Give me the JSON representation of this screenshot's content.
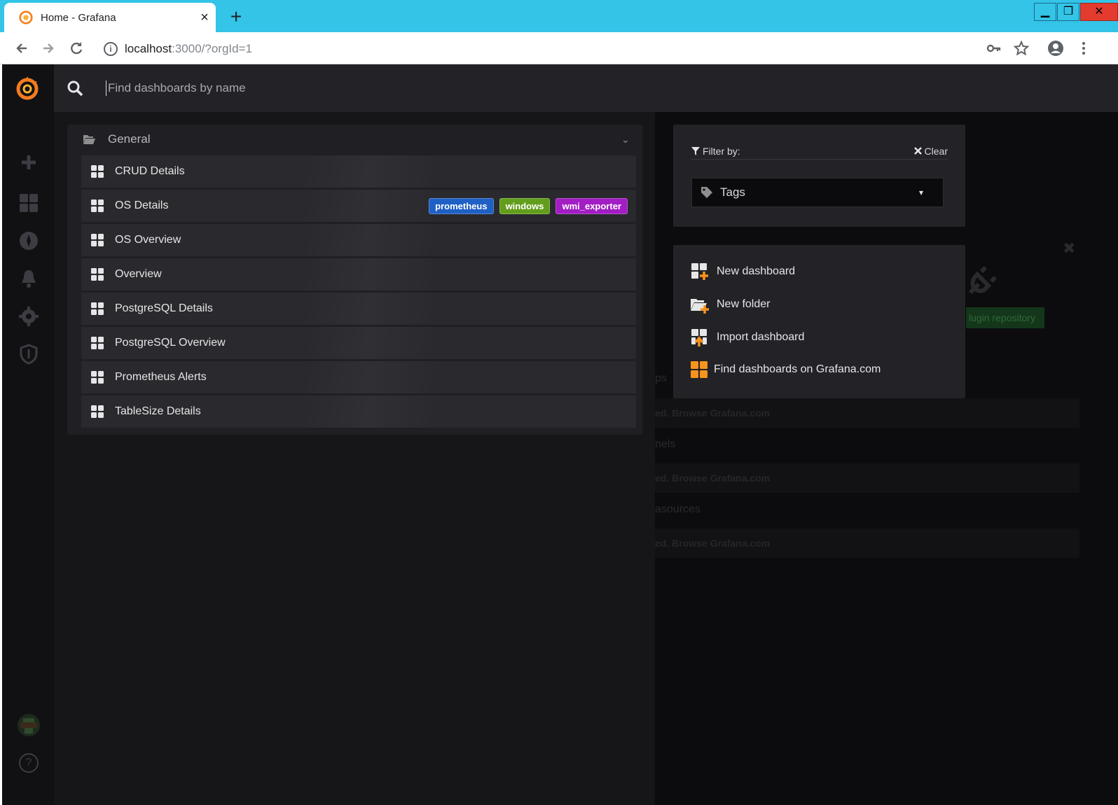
{
  "browser": {
    "tab_title": "Home - Grafana",
    "tab_close": "×",
    "new_tab": "+",
    "window_min": "▁",
    "window_max": "❐",
    "window_close": "✕",
    "url_host": "localhost",
    "url_path": ":3000/?orgId=1",
    "info_icon": "i"
  },
  "search": {
    "placeholder": "Find dashboards by name"
  },
  "folder": {
    "name": "General",
    "chevron": "⌄"
  },
  "dashboards": [
    {
      "name": "CRUD Details",
      "tags": []
    },
    {
      "name": "OS Details",
      "tags": [
        "prometheus",
        "windows",
        "wmi_exporter"
      ]
    },
    {
      "name": "OS Overview",
      "tags": []
    },
    {
      "name": "Overview",
      "tags": []
    },
    {
      "name": "PostgreSQL Details",
      "tags": []
    },
    {
      "name": "PostgreSQL Overview",
      "tags": []
    },
    {
      "name": "Prometheus Alerts",
      "tags": []
    },
    {
      "name": "TableSize Details",
      "tags": []
    }
  ],
  "tag_colors": {
    "prometheus": "#1f60c4",
    "windows": "#629e1b",
    "wmi_exporter": "#a21dc4"
  },
  "filter": {
    "label": "Filter by:",
    "clear_label": "Clear",
    "tags_label": "Tags",
    "caret": "▾"
  },
  "actions": [
    {
      "label": "New dashboard"
    },
    {
      "label": "New folder"
    },
    {
      "label": "Import dashboard"
    },
    {
      "label": "Find dashboards on Grafana.com"
    }
  ],
  "background": {
    "plugin_repo": "lugin repository",
    "ps": "ps",
    "nels": "nels",
    "asources": "asources",
    "browse_1": "ed. Browse Grafana.com",
    "browse_2": "ed. Browse Grafana.com",
    "browse_3": "ed. Browse Grafana.com",
    "close_x": "✖"
  },
  "sidebar": {
    "help": "?"
  },
  "colors": {
    "accent_orange": "#f7941d",
    "panel_bg": "#222227",
    "chrome_tab": "#33c4e8"
  }
}
